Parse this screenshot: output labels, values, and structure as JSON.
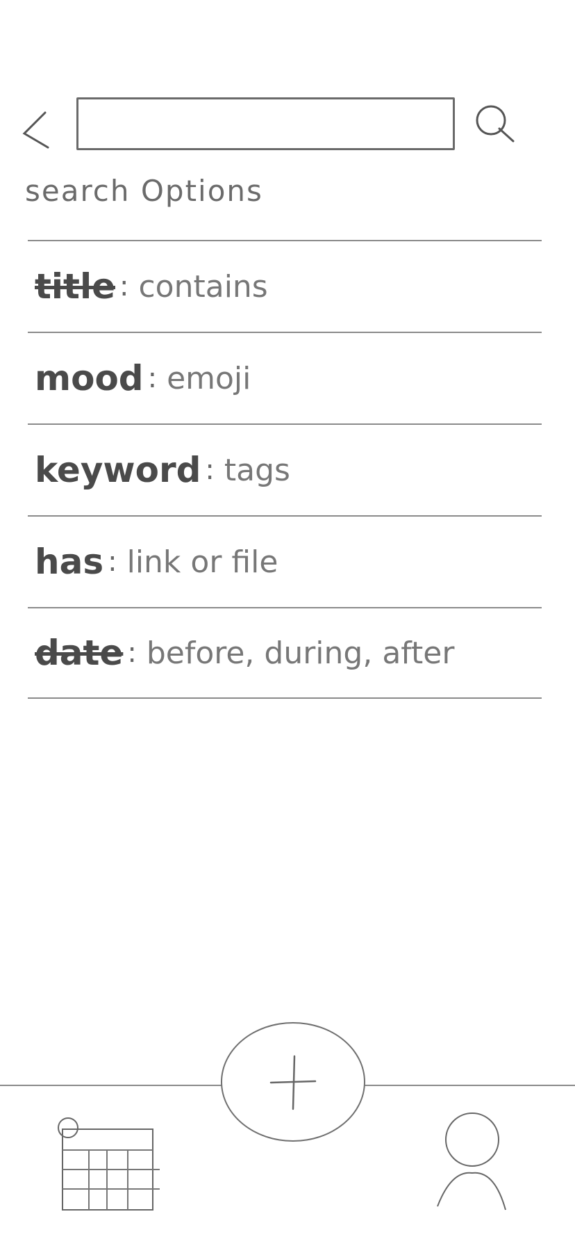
{
  "search": {
    "value": "",
    "placeholder": ""
  },
  "icons": {
    "back": "chevron-left-icon",
    "search": "search-icon",
    "add": "plus-icon",
    "calendar": "calendar-icon",
    "profile": "person-icon"
  },
  "heading": "search Options",
  "options": [
    {
      "key": "title",
      "sep": ":",
      "value": "contains"
    },
    {
      "key": "mood",
      "sep": ":",
      "value": "emoji"
    },
    {
      "key": "keyword",
      "sep": ":",
      "value": "tags"
    },
    {
      "key": "has",
      "sep": ":",
      "value": "link or file"
    },
    {
      "key": "date",
      "sep": ":",
      "value": "before, during, after"
    }
  ]
}
